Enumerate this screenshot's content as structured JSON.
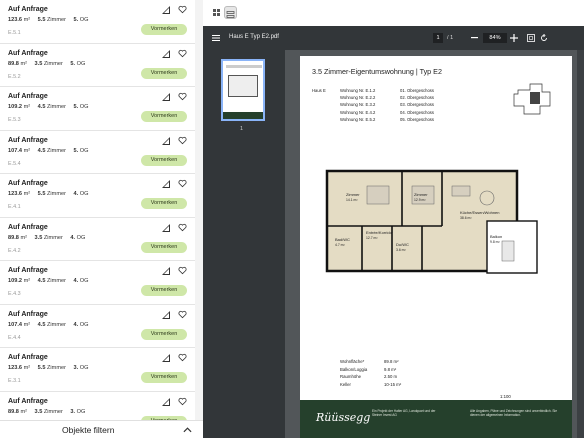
{
  "listing": {
    "rows": [
      {
        "title": "Auf Anfrage",
        "area": "123.6",
        "unit": "m²",
        "rooms": "5.5",
        "rooms_label": "Zimmer",
        "floor": "5.",
        "floor_label": "OG",
        "id": "E.5.1",
        "button": "Vormerken"
      },
      {
        "title": "Auf Anfrage",
        "area": "89.8",
        "unit": "m²",
        "rooms": "3.5",
        "rooms_label": "Zimmer",
        "floor": "5.",
        "floor_label": "OG",
        "id": "E.5.2",
        "button": "Vormerken"
      },
      {
        "title": "Auf Anfrage",
        "area": "109.2",
        "unit": "m²",
        "rooms": "4.5",
        "rooms_label": "Zimmer",
        "floor": "5.",
        "floor_label": "OG",
        "id": "E.5.3",
        "button": "Vormerken"
      },
      {
        "title": "Auf Anfrage",
        "area": "107.4",
        "unit": "m²",
        "rooms": "4.5",
        "rooms_label": "Zimmer",
        "floor": "5.",
        "floor_label": "OG",
        "id": "E.5.4",
        "button": "Vormerken"
      },
      {
        "title": "Auf Anfrage",
        "area": "123.6",
        "unit": "m²",
        "rooms": "5.5",
        "rooms_label": "Zimmer",
        "floor": "4.",
        "floor_label": "OG",
        "id": "E.4.1",
        "button": "Vormerken"
      },
      {
        "title": "Auf Anfrage",
        "area": "89.8",
        "unit": "m²",
        "rooms": "3.5",
        "rooms_label": "Zimmer",
        "floor": "4.",
        "floor_label": "OG",
        "id": "E.4.2",
        "button": "Vormerken"
      },
      {
        "title": "Auf Anfrage",
        "area": "109.2",
        "unit": "m²",
        "rooms": "4.5",
        "rooms_label": "Zimmer",
        "floor": "4.",
        "floor_label": "OG",
        "id": "E.4.3",
        "button": "Vormerken"
      },
      {
        "title": "Auf Anfrage",
        "area": "107.4",
        "unit": "m²",
        "rooms": "4.5",
        "rooms_label": "Zimmer",
        "floor": "4.",
        "floor_label": "OG",
        "id": "E.4.4",
        "button": "Vormerken"
      },
      {
        "title": "Auf Anfrage",
        "area": "123.6",
        "unit": "m²",
        "rooms": "5.5",
        "rooms_label": "Zimmer",
        "floor": "3.",
        "floor_label": "OG",
        "id": "E.3.1",
        "button": "Vormerken"
      },
      {
        "title": "Auf Anfrage",
        "area": "89.8",
        "unit": "m²",
        "rooms": "3.5",
        "rooms_label": "Zimmer",
        "floor": "3.",
        "floor_label": "OG",
        "id": "E.3.2",
        "button": "Vormerken"
      }
    ],
    "filter_label": "Objekte filtern"
  },
  "viewer": {
    "title": "Haus E Typ E2.pdf",
    "page_current": "1",
    "page_total": "/ 1",
    "zoom": "84%",
    "thumb_label": "1"
  },
  "pdf": {
    "heading": "3.5 Zimmer-Eigentumswohnung | Typ E2",
    "haus": "Haus E",
    "units": [
      {
        "name": "Wohnung Nr. E.1.2",
        "floor": "01. Obergeschoss"
      },
      {
        "name": "Wohnung Nr. E.2.2",
        "floor": "02. Obergeschoss"
      },
      {
        "name": "Wohnung Nr. E.3.2",
        "floor": "03. Obergeschoss"
      },
      {
        "name": "Wohnung Nr. E.4.2",
        "floor": "04. Obergeschoss"
      },
      {
        "name": "Wohnung Nr. E.5.2",
        "floor": "05. Obergeschoss"
      }
    ],
    "rooms": {
      "zimmer1": "Zimmer",
      "zimmer1_a": "14.1 m²",
      "zimmer2": "Zimmer",
      "zimmer2_a": "12.9 m²",
      "wohnen": "Küche/Essen/Wohnen",
      "wohnen_a": "38.6 m²",
      "bad": "Bad/WC",
      "bad_a": "4.7 m²",
      "entree": "Entrée/Korridor",
      "entree_a": "12.7 m²",
      "dusche": "Du/WC",
      "dusche_a": "3.6 m²",
      "balkon": "Balkon",
      "balkon_a": "9.8 m²"
    },
    "specs": [
      {
        "label": "Wohnfläche*",
        "value": "89.8 m²"
      },
      {
        "label": "Balkon/Loggia",
        "value": "9.8 m²"
      },
      {
        "label": "Raumhöhe",
        "value": "2.50 m"
      },
      {
        "label": "Keller",
        "value": "10-15 m²"
      }
    ],
    "scale": "1:100",
    "scale_ticks": [
      "0",
      "1",
      "2",
      "3m"
    ],
    "logo": "Rüüssegg",
    "footer_left": "Ein Projekt der Halter AG, Landquart und der Steiner Invest AG",
    "footer_right": "Alle Angaben, Pläne und Zeichnungen sind unverbindlich. Sie dienen der allgemeinen Information."
  },
  "colors": {
    "accent": "#cfe7a8",
    "viewer_bg": "#525659",
    "toolbar": "#323639",
    "footer": "#25402c"
  }
}
